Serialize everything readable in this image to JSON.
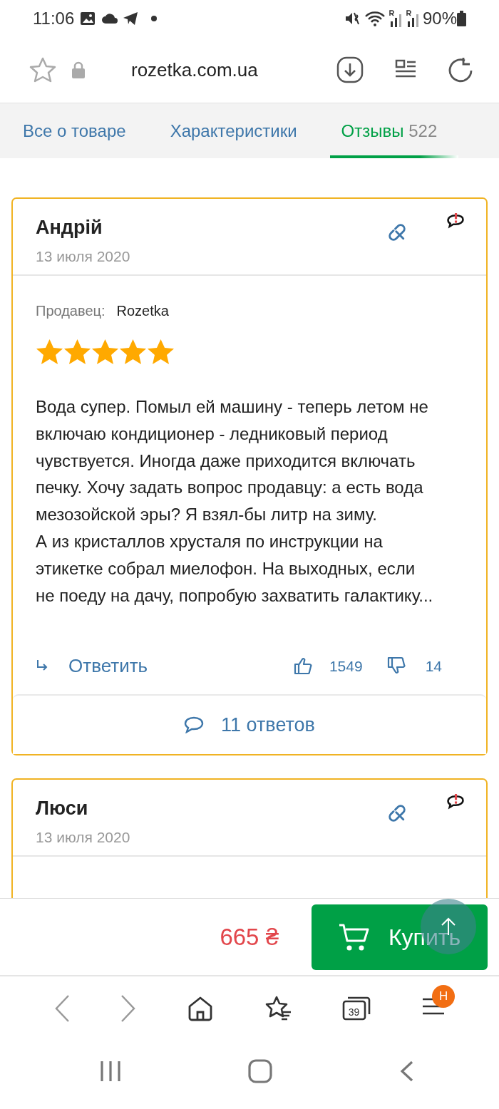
{
  "status_bar": {
    "time": "11:06",
    "battery": "90%"
  },
  "browser": {
    "url": "rozetka.com.ua",
    "tab_count": "39",
    "menu_badge": "H"
  },
  "tabs": [
    {
      "label": "Все о товаре",
      "selected": false
    },
    {
      "label": "Характеристики",
      "selected": false
    },
    {
      "label": "Отзывы",
      "count": "522",
      "selected": true
    }
  ],
  "reviews": [
    {
      "author": "Андрій",
      "date": "13 июля 2020",
      "seller_label": "Продавец:",
      "seller": "Rozetka",
      "stars": 5,
      "text": "Вода супер. Помыл ей машину - теперь летом не включаю кондиционер - ледниковый период чувствуется. Иногда даже приходится включать печку. Хочу задать вопрос продавцу: а есть вода мезозойской эры? Я взял-бы литр на зиму.\nА из кристаллов хрусталя по инструкции на этикетке собрал миелофон. На выходных, если не поеду на дачу, попробую захватить галактику...",
      "reply_label": "Ответить",
      "likes": "1549",
      "dislikes": "14",
      "replies": "11 ответов"
    },
    {
      "author": "Люси",
      "date": "13 июля 2020"
    }
  ],
  "buy_bar": {
    "price": "665 ₴",
    "buy_label": "Купить"
  }
}
